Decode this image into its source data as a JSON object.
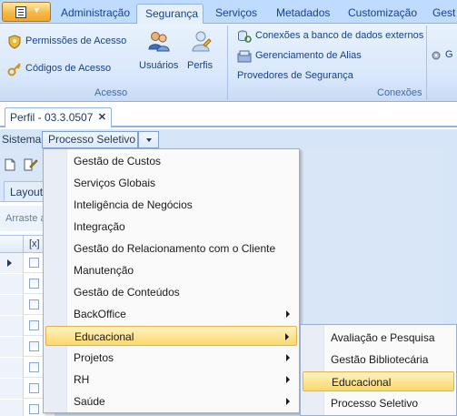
{
  "ribbon": {
    "tabs": [
      {
        "label": "Administração",
        "active": false
      },
      {
        "label": "Segurança",
        "active": true
      },
      {
        "label": "Serviços",
        "active": false
      },
      {
        "label": "Metadados",
        "active": false
      },
      {
        "label": "Customização",
        "active": false
      },
      {
        "label": "Gest",
        "active": false
      }
    ],
    "acesso": {
      "permissoes": "Permissões de Acesso",
      "codigos": "Códigos de Acesso",
      "usuarios": "Usuários",
      "perfis": "Perfis",
      "group_label": "Acesso"
    },
    "conexoes": {
      "externos": "Conexões a banco de dados externos",
      "alias": "Gerenciamento de Alias",
      "provedores": "Provedores de Segurança",
      "group_label": "Conexões"
    },
    "extra": {
      "label": "G"
    }
  },
  "document": {
    "tab_label": "Perfil - 03.3.0507"
  },
  "sistema": {
    "label": "Sistema:",
    "value": "Processo Seletivo"
  },
  "form": {
    "layout_tab": "Layout",
    "arraste": "Arraste a",
    "check_header": "[x]",
    "row_count": 8
  },
  "menu": {
    "items": [
      {
        "label": "Gestão de Custos",
        "submenu": false
      },
      {
        "label": "Serviços Globais",
        "submenu": false
      },
      {
        "label": "Inteligência de Negócios",
        "submenu": false
      },
      {
        "label": "Integração",
        "submenu": false
      },
      {
        "label": "Gestão do Relacionamento com o Cliente",
        "submenu": false
      },
      {
        "label": "Manutenção",
        "submenu": false
      },
      {
        "label": "Gestão de Conteúdos",
        "submenu": false
      },
      {
        "label": "BackOffice",
        "submenu": true
      },
      {
        "label": "Educacional",
        "submenu": true,
        "highlighted": true
      },
      {
        "label": "Projetos",
        "submenu": true
      },
      {
        "label": "RH",
        "submenu": true
      },
      {
        "label": "Saúde",
        "submenu": true
      }
    ]
  },
  "submenu": {
    "items": [
      {
        "label": "Avaliação e Pesquisa"
      },
      {
        "label": "Gestão Bibliotecária"
      },
      {
        "label": "Educacional",
        "highlighted": true
      },
      {
        "label": "Processo Seletivo"
      }
    ]
  },
  "colors": {
    "ribbon_tab_bg": "#bfdbff",
    "ribbon_body": "#dbe8fb",
    "menu_highlight": "#fbd86a",
    "text": "#1e395b"
  }
}
